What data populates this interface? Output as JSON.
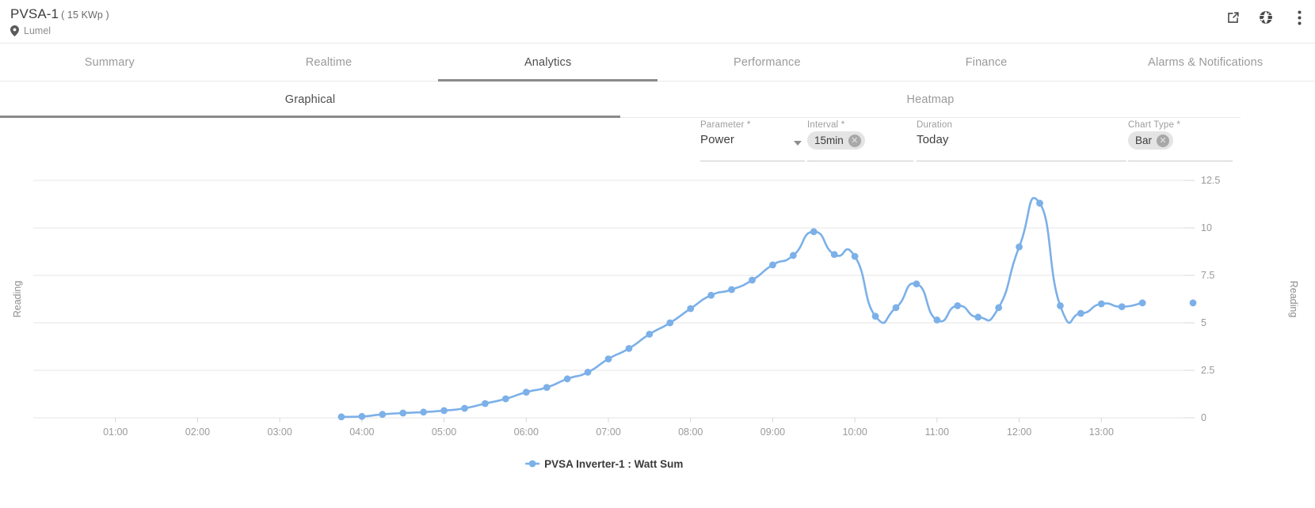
{
  "header": {
    "plant_name": "PVSA-1",
    "capacity": "( 15 KWp )",
    "location": "Lumel",
    "icons": [
      {
        "name": "open-in-new-icon",
        "label": "Open in new window"
      },
      {
        "name": "globe-icon",
        "label": "Public view"
      },
      {
        "name": "more-vert-icon",
        "label": "More options"
      }
    ]
  },
  "main_tabs": [
    {
      "label": "Summary",
      "active": false
    },
    {
      "label": "Realtime",
      "active": false
    },
    {
      "label": "Analytics",
      "active": true
    },
    {
      "label": "Performance",
      "active": false
    },
    {
      "label": "Finance",
      "active": false
    },
    {
      "label": "Alarms & Notifications",
      "active": false
    }
  ],
  "sub_tabs": [
    {
      "label": "Graphical",
      "active": true
    },
    {
      "label": "Heatmap",
      "active": false
    }
  ],
  "controls": {
    "parameter": {
      "label": "Parameter *",
      "value": "Power"
    },
    "interval": {
      "label": "Interval *",
      "chip": "15min",
      "chip_close": "✕"
    },
    "duration": {
      "label": "Duration",
      "value": "Today"
    },
    "chart_type": {
      "label": "Chart Type *",
      "chip": "Bar",
      "chip_close": "✕"
    }
  },
  "chart_data": {
    "type": "line",
    "title": "",
    "xlabel": "",
    "ylabel": "Reading",
    "ylabel_right": "Reading",
    "grid": true,
    "legend_position": "bottom",
    "accent_color": "#7cb0e8",
    "ylim": [
      0,
      13.4
    ],
    "yticks": [
      0,
      2.5,
      5,
      7.5,
      10,
      12.5
    ],
    "ytick_labels": [
      "0",
      "2.5",
      "5",
      "7.5",
      "10",
      "12.5"
    ],
    "xlim": [
      "00:00",
      "14:00"
    ],
    "xticks": [
      "01:00",
      "02:00",
      "03:00",
      "04:00",
      "05:00",
      "06:00",
      "07:00",
      "08:00",
      "09:00",
      "10:00",
      "11:00",
      "12:00",
      "13:00"
    ],
    "series": [
      {
        "name": "PVSA Inverter-1 : Watt Sum",
        "color": "#7cb0e8",
        "x": [
          "03:45",
          "04:00",
          "04:15",
          "04:30",
          "04:45",
          "05:00",
          "05:15",
          "05:30",
          "05:45",
          "06:00",
          "06:15",
          "06:30",
          "06:45",
          "07:00",
          "07:15",
          "07:30",
          "07:45",
          "08:00",
          "08:15",
          "08:30",
          "08:45",
          "09:00",
          "09:15",
          "09:30",
          "09:45",
          "10:00",
          "10:15",
          "10:30",
          "10:45",
          "11:00",
          "11:15",
          "11:30",
          "11:45",
          "12:00",
          "12:15",
          "12:30",
          "12:45",
          "13:00",
          "13:15",
          "13:30"
        ],
        "values": [
          0.05,
          0.07,
          0.18,
          0.25,
          0.3,
          0.38,
          0.5,
          0.75,
          1.0,
          1.35,
          1.6,
          2.05,
          2.4,
          3.1,
          3.65,
          4.4,
          5.0,
          5.75,
          6.45,
          6.75,
          7.25,
          8.05,
          8.55,
          9.8,
          8.6,
          8.5,
          5.35,
          5.8,
          7.05,
          5.15,
          5.9,
          5.3,
          5.8,
          9.0,
          11.3,
          5.9,
          5.5,
          6.0,
          5.85,
          6.05
        ]
      }
    ]
  },
  "legend": {
    "label": "PVSA Inverter-1 : Watt Sum"
  }
}
